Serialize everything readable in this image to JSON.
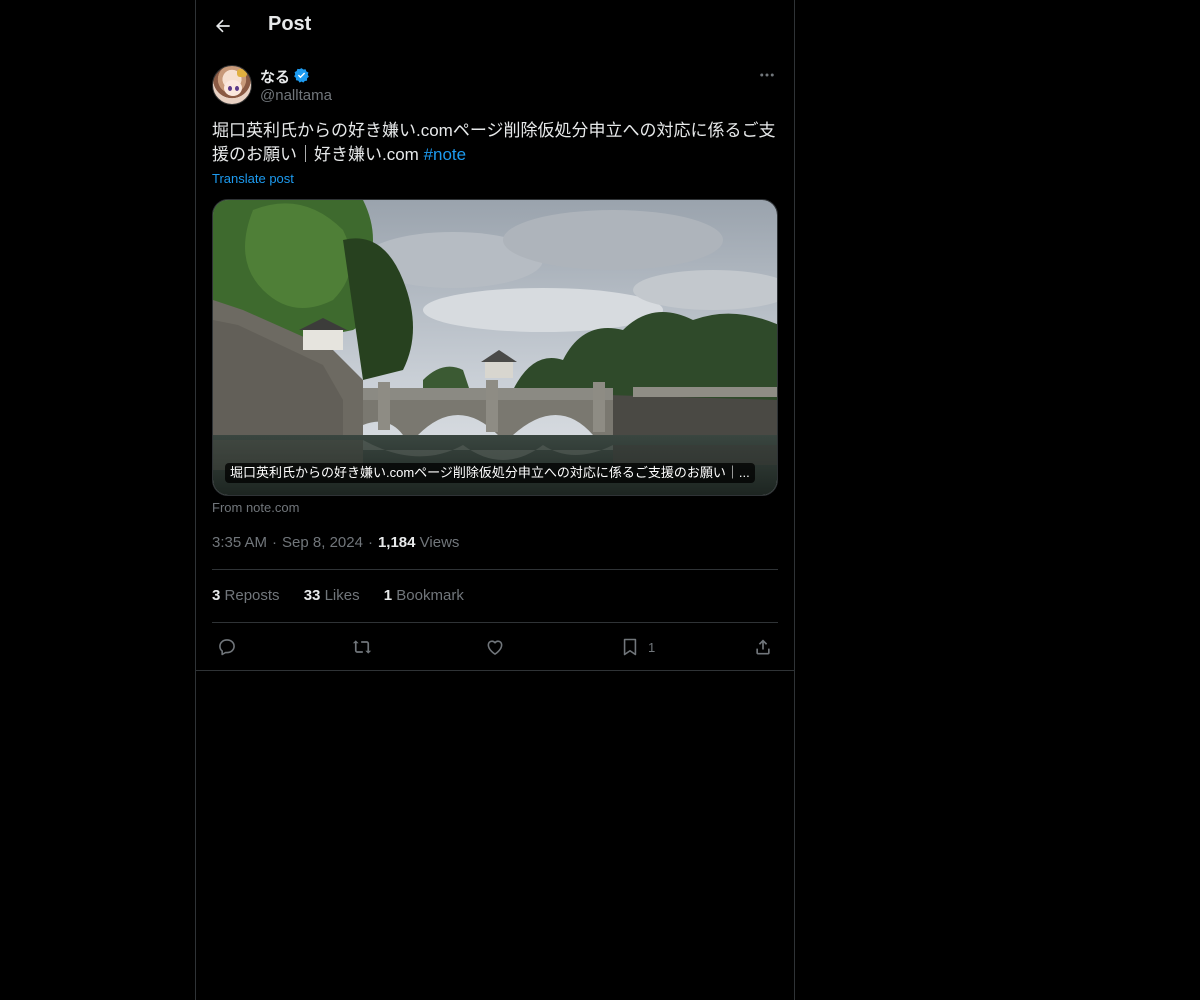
{
  "header": {
    "title": "Post"
  },
  "author": {
    "display_name": "なる",
    "handle": "@nalltama",
    "verified": true
  },
  "post": {
    "text": "堀口英利氏からの好き嫌い.comページ削除仮処分申立への対応に係るご支援のお願い｜好き嫌い.com ",
    "hashtag": "#note",
    "translate_label": "Translate post"
  },
  "card": {
    "caption": "堀口英利氏からの好き嫌い.comページ削除仮処分申立への対応に係るご支援のお願い｜...",
    "from_label": "From note.com"
  },
  "meta": {
    "time": "3:35 AM",
    "date": "Sep 8, 2024",
    "views_count": "1,184",
    "views_label": "Views"
  },
  "stats": [
    {
      "count": "3",
      "label": "Reposts"
    },
    {
      "count": "33",
      "label": "Likes"
    },
    {
      "count": "1",
      "label": "Bookmark"
    }
  ],
  "actions": {
    "reply_icon": "reply-icon",
    "repost_icon": "repost-icon",
    "like_icon": "heart-icon",
    "bookmark_icon": "bookmark-icon",
    "bookmark_count": "1",
    "share_icon": "share-icon"
  },
  "colors": {
    "accent": "#1d9bf0",
    "text": "#e7e9ea",
    "muted": "#71767b",
    "border": "#2f3336",
    "background": "#000000"
  }
}
